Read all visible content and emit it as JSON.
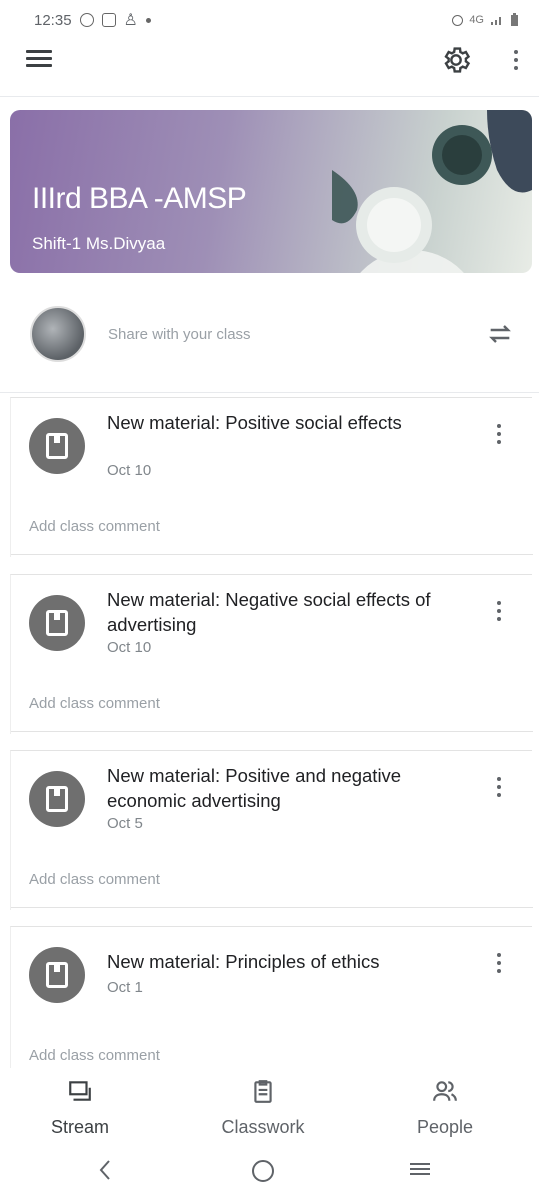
{
  "status_bar": {
    "time": "12:35",
    "right": "4G"
  },
  "banner": {
    "title": "IIIrd BBA -AMSP",
    "subtitle": "Shift-1 Ms.Divyaa"
  },
  "share": {
    "placeholder": "Share with your class"
  },
  "posts": [
    {
      "title": "New material: Positive social effects",
      "date": "Oct 10",
      "comment": "Add class comment"
    },
    {
      "title": "New material: Negative social effects of advertising",
      "date": "Oct 10",
      "comment": "Add class comment"
    },
    {
      "title": "New material: Positive and negative economic advertising",
      "date": "Oct 5",
      "comment": "Add class comment"
    },
    {
      "title": "New material: Principles of ethics",
      "date": "Oct 1",
      "comment": "Add class comment"
    }
  ],
  "bottom_nav": [
    {
      "label": "Stream",
      "icon": "stream-icon"
    },
    {
      "label": "Classwork",
      "icon": "classwork-icon"
    },
    {
      "label": "People",
      "icon": "people-icon"
    }
  ],
  "icons": {
    "menu": "menu-icon",
    "settings": "gear-icon",
    "more": "more-vert-icon",
    "repost": "repost-icon",
    "material": "material-icon"
  }
}
